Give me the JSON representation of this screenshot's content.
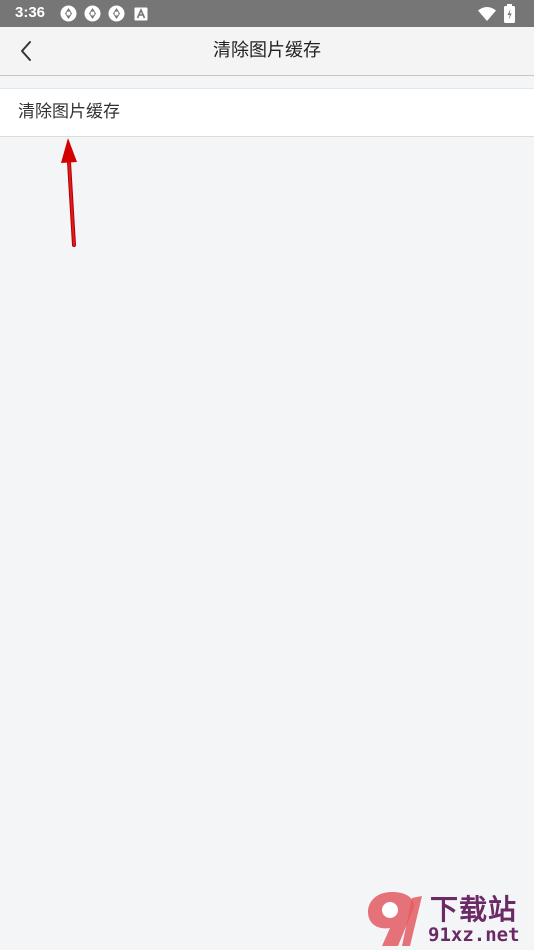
{
  "status_bar": {
    "time": "3:36",
    "left_icons": [
      "app-notification-icon",
      "app-notification-icon",
      "app-notification-icon",
      "a-badge-icon"
    ],
    "right_icons": [
      "wifi-icon",
      "battery-charging-icon"
    ],
    "background": "#767676"
  },
  "header": {
    "title": "清除图片缓存",
    "back_icon": "chevron-left-icon"
  },
  "settings": {
    "items": [
      {
        "label": "清除图片缓存"
      }
    ]
  },
  "annotation": {
    "arrow_color": "#d40000"
  },
  "watermark": {
    "title": "下载站",
    "domain": "91xz.net",
    "logo_text": "9"
  }
}
